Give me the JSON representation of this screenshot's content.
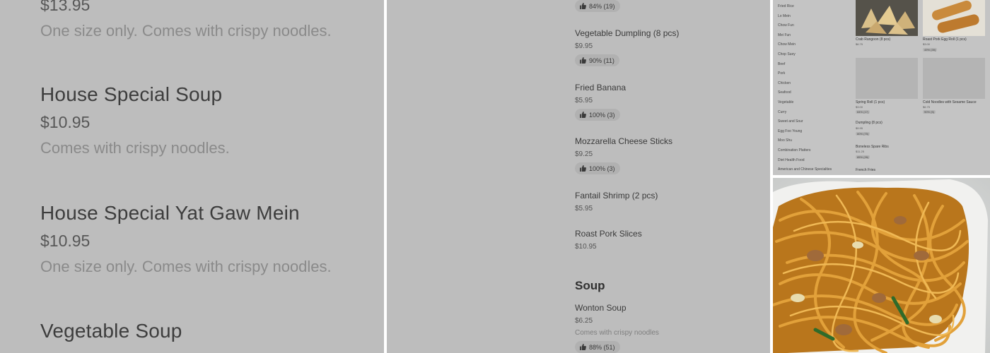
{
  "zoom_panel": {
    "items": [
      {
        "price": "$13.95",
        "description": "One size only. Comes with crispy noodles."
      },
      {
        "name": "House Special Soup",
        "price": "$10.95",
        "description": "Comes with crispy noodles."
      },
      {
        "name": "House Special Yat Gaw Mein",
        "price": "$10.95",
        "description": "One size only. Comes with crispy noodles."
      },
      {
        "name": "Vegetable Soup"
      }
    ]
  },
  "menu_panel": {
    "items": [
      {
        "rating": "84% (19)"
      },
      {
        "name": "Vegetable Dumpling (8 pcs)",
        "price": "$9.95",
        "rating": "90% (11)"
      },
      {
        "name": "Fried Banana",
        "price": "$5.95",
        "rating": "100% (3)"
      },
      {
        "name": "Mozzarella Cheese Sticks",
        "price": "$9.25",
        "rating": "100% (3)"
      },
      {
        "name": "Fantail Shrimp (2 pcs)",
        "price": "$5.95"
      },
      {
        "name": "Roast Pork Slices",
        "price": "$10.95"
      }
    ],
    "section_title": "Soup",
    "soup_items": [
      {
        "name": "Wonton Soup",
        "price": "$6.25",
        "description": "Comes with crispy noodles",
        "rating": "88% (51)"
      }
    ]
  },
  "mini_site": {
    "categories": [
      "Fried Rice",
      "Lo Mein",
      "Chow Fun",
      "Mei Fun",
      "Chow Mein",
      "Chop Suey",
      "Beef",
      "Pork",
      "Chicken",
      "Seafood",
      "Vegetable",
      "Curry",
      "Sweet and Sour",
      "Egg Foo Young",
      "Moo Shu",
      "Combination Platters",
      "Diet Health Food",
      "American and Chinese Specialties"
    ],
    "cards": [
      {
        "name": "Crab Rangoon (8 pcs)",
        "price": "$6.75"
      },
      {
        "name": "Roast Pork Egg Roll (1 pcs)",
        "price": "$3.00",
        "rating": "49% (39)"
      },
      {
        "name": "Spring Roll (1 pcs)",
        "price": "$3.00",
        "rating": "84% (17)"
      },
      {
        "name": "Cold Noodles with Sesame Sauce",
        "price": "$6.75",
        "rating": "90% (5)"
      },
      {
        "name": "Dumpling (8 pcs)",
        "price": "$9.95",
        "rating": "80% (75)"
      },
      {
        "name": "Boneless Spare Ribs",
        "price": "$11.25",
        "rating": "85% (26)"
      },
      {
        "name": "French Fries"
      }
    ]
  },
  "colors": {
    "panel_bg": "#bdbdbd",
    "chip_bg": "#b1b1b1",
    "noodle": "#d9941e"
  }
}
